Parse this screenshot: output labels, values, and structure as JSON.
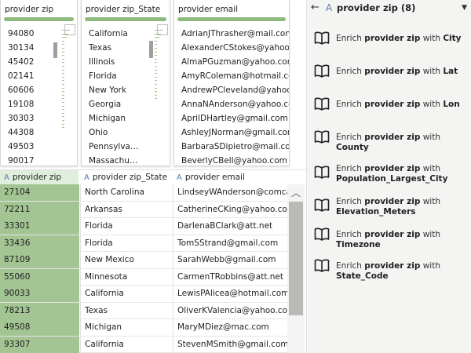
{
  "profile": {
    "col1": {
      "title": "provider zip",
      "values": [
        "94080",
        "30134",
        "45402",
        "02141",
        "60606",
        "19108",
        "30303",
        "44308",
        "49503",
        "90017"
      ]
    },
    "col2": {
      "title": "provider zip_State",
      "values": [
        "California",
        "Texas",
        "Illinois",
        "Florida",
        "New York",
        "Georgia",
        "Michigan",
        "Ohio",
        "Pennsylva…",
        "Massachu…"
      ]
    },
    "col3": {
      "title": "provider email",
      "values": [
        "AdrianJThrasher@mail.com",
        "AlexanderCStokes@yahoo.c…",
        "AlmaPGuzman@yahoo.com",
        "AmyRColeman@hotmail.com",
        "AndrewPCleveland@yahoo.c…",
        "AnnaNAnderson@yahoo.com",
        "AprilDHartley@gmail.com",
        "AshleyJNorman@gmail.com",
        "BarbaraSDipietro@mail.com",
        "BeverlyCBell@yahoo.com"
      ]
    }
  },
  "headers": {
    "zip": "provider zip",
    "state": "provider zip_State",
    "email": "provider email",
    "type_glyph": "A"
  },
  "rows": [
    {
      "zip": "27104",
      "state": "North Carolina",
      "email": "LindseyWAnderson@comcast.net"
    },
    {
      "zip": "72211",
      "state": "Arkansas",
      "email": "CatherineCKing@yahoo.com"
    },
    {
      "zip": "33301",
      "state": "Florida",
      "email": "DarlenaBClark@att.net"
    },
    {
      "zip": "33436",
      "state": "Florida",
      "email": "TomSStrand@gmail.com"
    },
    {
      "zip": "87109",
      "state": "New Mexico",
      "email": "SarahWebb@gmail.com"
    },
    {
      "zip": "55060",
      "state": "Minnesota",
      "email": "CarmenTRobbins@att.net"
    },
    {
      "zip": "90033",
      "state": "California",
      "email": "LewisPAlicea@hotmail.com"
    },
    {
      "zip": "78213",
      "state": "Texas",
      "email": "OliverKValencia@yahoo.com"
    },
    {
      "zip": "49508",
      "state": "Michigan",
      "email": "MaryMDiez@mac.com"
    },
    {
      "zip": "93307",
      "state": "California",
      "email": "StevenMSmith@gmail.com"
    }
  ],
  "panel": {
    "back_glyph": "←",
    "type_glyph": "A",
    "title": "provider zip (8)",
    "caret_glyph": "▼",
    "enrich_prefix": "Enrich",
    "enrich_with": "with",
    "subject": "provider zip",
    "items": [
      {
        "target": "City"
      },
      {
        "target": "Lat"
      },
      {
        "target": "Lon"
      },
      {
        "target": "County"
      },
      {
        "target": "Population_Largest_City"
      },
      {
        "target": "Elevation_Meters"
      },
      {
        "target": "Timezone"
      },
      {
        "target": "State_Code"
      }
    ]
  },
  "scroll": {
    "up_glyph": "︿"
  },
  "colors": {
    "zip_cell": "#a3c493",
    "zip_header": "#dfeedd",
    "quality_bar": "#8fb97f",
    "panel_bg": "#f4f4f3",
    "type_icon": "#5a7ea8"
  }
}
